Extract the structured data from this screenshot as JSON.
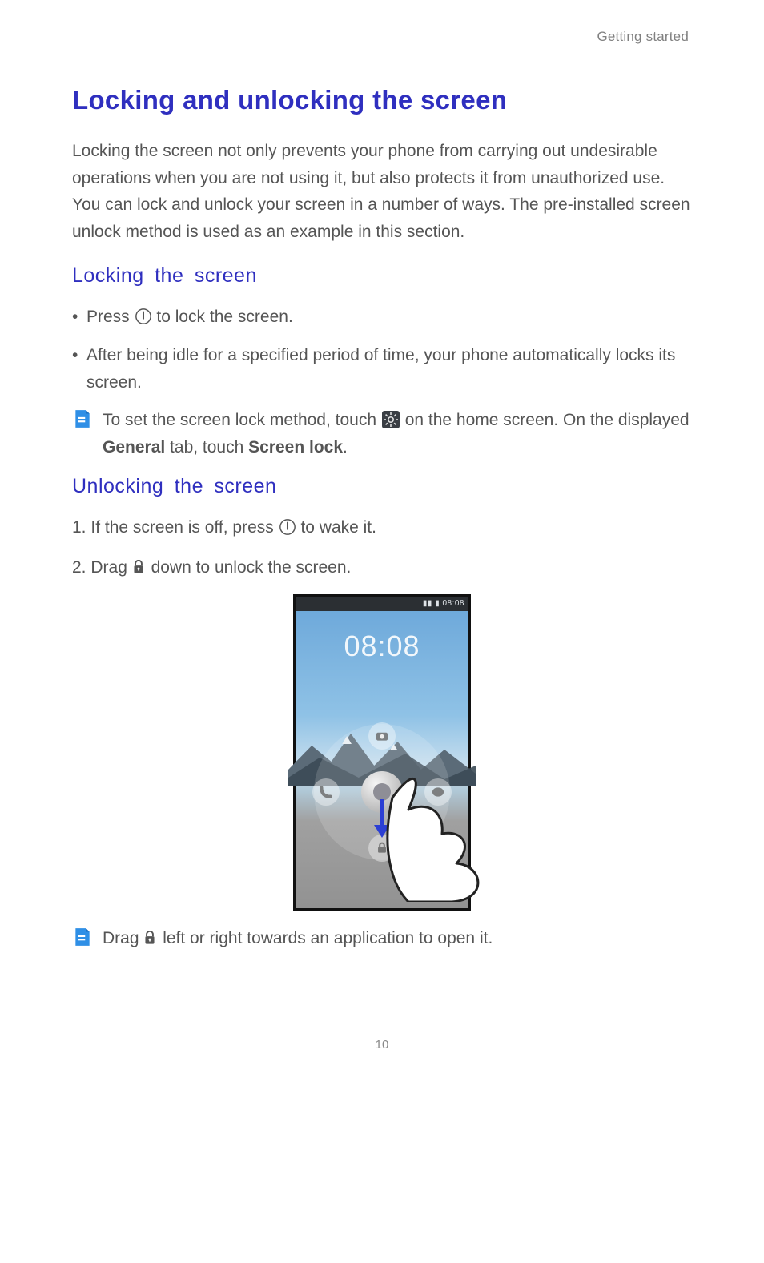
{
  "header": {
    "chapter": "Getting started"
  },
  "title": "Locking and unlocking the screen",
  "intro": "Locking the screen not only prevents your phone from carrying out undesirable operations when you are not using it, but also protects it from unauthorized use. You can lock and unlock your screen in a number of ways. The pre-installed screen unlock method is used as an example in this section.",
  "sections": {
    "locking": {
      "heading": "Locking the screen",
      "bullet1_pre": "Press ",
      "bullet1_post": " to lock the screen.",
      "bullet2": "After being idle for a specified period of time, your phone automatically locks its screen.",
      "note_pre": "To set the screen lock method, touch ",
      "note_mid": " on the home screen. On the displayed ",
      "note_bold1": "General",
      "note_after1": " tab, touch ",
      "note_bold2": "Screen lock",
      "note_end": "."
    },
    "unlocking": {
      "heading": "Unlocking the screen",
      "step1_pre": "If the screen is off, press ",
      "step1_post": " to wake it.",
      "step2_pre": "Drag ",
      "step2_post": " down to unlock the screen.",
      "note_pre": "Drag ",
      "note_post": " left or right towards an application to open it."
    }
  },
  "phone": {
    "status_time": "08:08",
    "clock": "08:08"
  },
  "page_number": "10"
}
